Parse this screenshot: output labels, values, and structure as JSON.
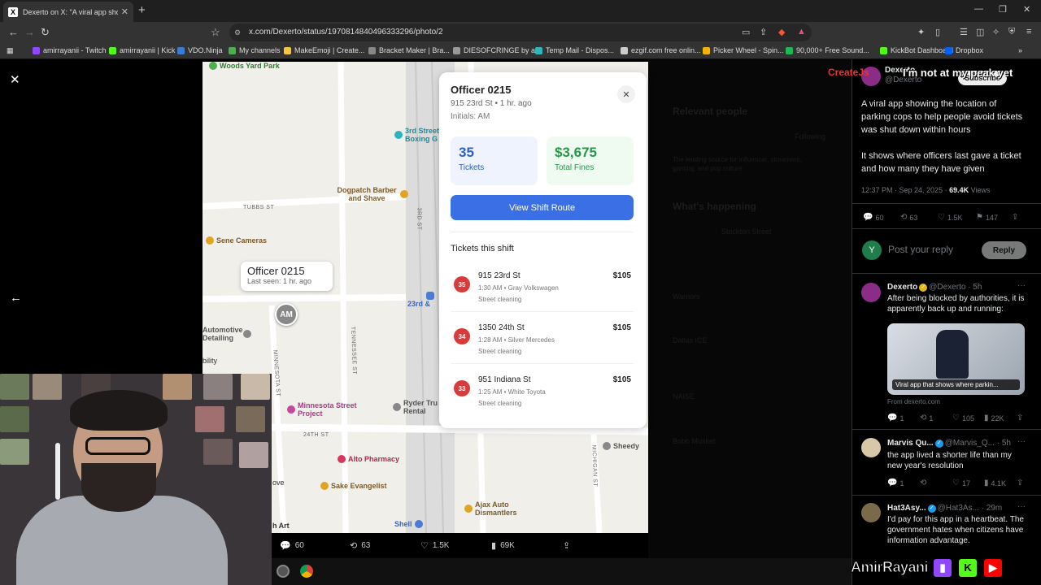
{
  "browser": {
    "tab_title": "Dexerto on X: \"A viral app showi",
    "tab_favicon": "X",
    "url": "x.com/Dexerto/status/1970814840496333296/photo/2",
    "bookmarks": [
      {
        "label": "amirrayanii - Twitch",
        "color": "#9146ff"
      },
      {
        "label": "amirrayanii | Kick",
        "color": "#53fc18"
      },
      {
        "label": "VDO.Ninja",
        "color": "#3a7bd5"
      },
      {
        "label": "My channels",
        "color": "#4caf50"
      },
      {
        "label": "MakeEmoji | Create...",
        "color": "#f5c542"
      },
      {
        "label": "Bracket Maker | Bra...",
        "color": "#888888"
      },
      {
        "label": "DIESOFCRINGE by a...",
        "color": "#999999"
      },
      {
        "label": "Temp Mail - Dispos...",
        "color": "#2eb8b8"
      },
      {
        "label": "ezgif.com free onlin...",
        "color": "#cccccc"
      },
      {
        "label": "Picker Wheel - Spin...",
        "color": "#f4b400"
      },
      {
        "label": "90,000+ Free Sound...",
        "color": "#1db954"
      },
      {
        "label": "KickBot Dashboard",
        "color": "#53fc18"
      },
      {
        "label": "Dropbox",
        "color": "#0061ff"
      }
    ]
  },
  "map": {
    "pois": [
      {
        "label": "Woods Yard Park",
        "color": "#4caf50"
      },
      {
        "label": "3rd Street Boxing G",
        "color": "#2bb3c0"
      },
      {
        "label": "Dogpatch Barber and Shave",
        "color": "#e0a323"
      },
      {
        "label": "Sene Cameras",
        "color": "#e0a323"
      },
      {
        "label": "Automotive Detailing",
        "color": "#888888"
      },
      {
        "label": "Minnesota Street Project",
        "color": "#c7479c"
      },
      {
        "label": "Ryder Tru Rental",
        "color": "#888888"
      },
      {
        "label": "Alto Pharmacy",
        "color": "#d9365b"
      },
      {
        "label": "Sake Evangelist",
        "color": "#e0a323"
      },
      {
        "label": "Ajax Auto Dismantlers",
        "color": "#e0a323"
      },
      {
        "label": "Sheedy",
        "color": "#888888"
      },
      {
        "label": "Shell",
        "color": "#4a7bd5"
      },
      {
        "label": "23rd &",
        "color": "#4a7bd5"
      }
    ],
    "streets": [
      "TUBBS ST",
      "3RD ST",
      "TENNESSEE ST",
      "MINNESOTA ST",
      "24TH ST",
      "MICHIGAN ST"
    ],
    "edge_labels": [
      "bility",
      "ove",
      "h Art"
    ],
    "callout_name": "Officer 0215",
    "callout_seen": "Last seen: 1 hr. ago",
    "marker_initials": "AM"
  },
  "officer_card": {
    "name": "Officer 0215",
    "subtitle": "915 23rd St • 1 hr. ago",
    "initials": "Initials: AM",
    "tickets_value": "35",
    "tickets_label": "Tickets",
    "fines_value": "$3,675",
    "fines_label": "Total Fines",
    "route_button": "View Shift Route",
    "shift_heading": "Tickets this shift",
    "tickets": [
      {
        "num": "35",
        "addr": "915 23rd St",
        "meta": "1:30 AM • Gray Volkswagen",
        "reason": "Street cleaning",
        "amount": "$105"
      },
      {
        "num": "34",
        "addr": "1350 24th St",
        "meta": "1:28 AM • Silver Mercedes",
        "reason": "Street cleaning",
        "amount": "$105"
      },
      {
        "num": "33",
        "addr": "951 Indiana St",
        "meta": "1:25 AM • White Toyota",
        "reason": "Street cleaning",
        "amount": "$105"
      }
    ]
  },
  "engagement": {
    "replies": "60",
    "reposts": "63",
    "likes": "1.5K",
    "views": "69K"
  },
  "dimmed_panel": {
    "relevant": "Relevant people",
    "following": "Following",
    "bio": "The leading source for influencer, streamers, gaming, and pop culture",
    "whats_happening": "What's happening",
    "trend1": "Stockton Street",
    "trend2": "Warriors",
    "trend3": "Dallas ICE",
    "trend4": "NAISE",
    "trend5": "Bobb Musket"
  },
  "tweet": {
    "author": "Dexerto",
    "handle": "@Dexerto",
    "subscribe": "Subscribe",
    "text1": "A viral app showing the location of parking cops to help people avoid tickets was shut down within hours",
    "text2": "It shows where officers last gave a ticket and how many they have given",
    "time": "12:37 PM · Sep 24, 2025 · ",
    "views": "69.4K",
    "views_label": " Views",
    "stats": {
      "replies": "60",
      "reposts": "63",
      "likes": "1.5K",
      "bookmarks": "147"
    },
    "reply_placeholder": "Post your reply",
    "reply_button": "Reply",
    "reply_avatar": "Y"
  },
  "replies": [
    {
      "name": "Dexerto",
      "handle": "@Dexerto · 5h",
      "text": "After being blocked by authorities, it is apparently back up and running:",
      "media_caption": "Viral app that shows where parkin...",
      "source": "From dexerto.com",
      "stats": [
        "1",
        "1",
        "105",
        "22K"
      ]
    },
    {
      "name": "Marvis Qu...",
      "handle": "@Marvis_Q... · 5h",
      "text": "the app lived a shorter life than my new year's resolution",
      "stats": [
        "1",
        "",
        "17",
        "4.1K"
      ]
    },
    {
      "name": "Hat3Asy...",
      "handle": "@Hat3As... · 29m",
      "text": "I'd pay for this app in a heartbeat. The government hates when citizens have information advantage."
    }
  ],
  "stream_overlay": {
    "top_text": "I'm not at my peak yet",
    "brand_text": "CreateJs",
    "channel": "AmirRayani",
    "icons": [
      "twitch-icon",
      "kick-icon",
      "youtube-icon"
    ]
  }
}
